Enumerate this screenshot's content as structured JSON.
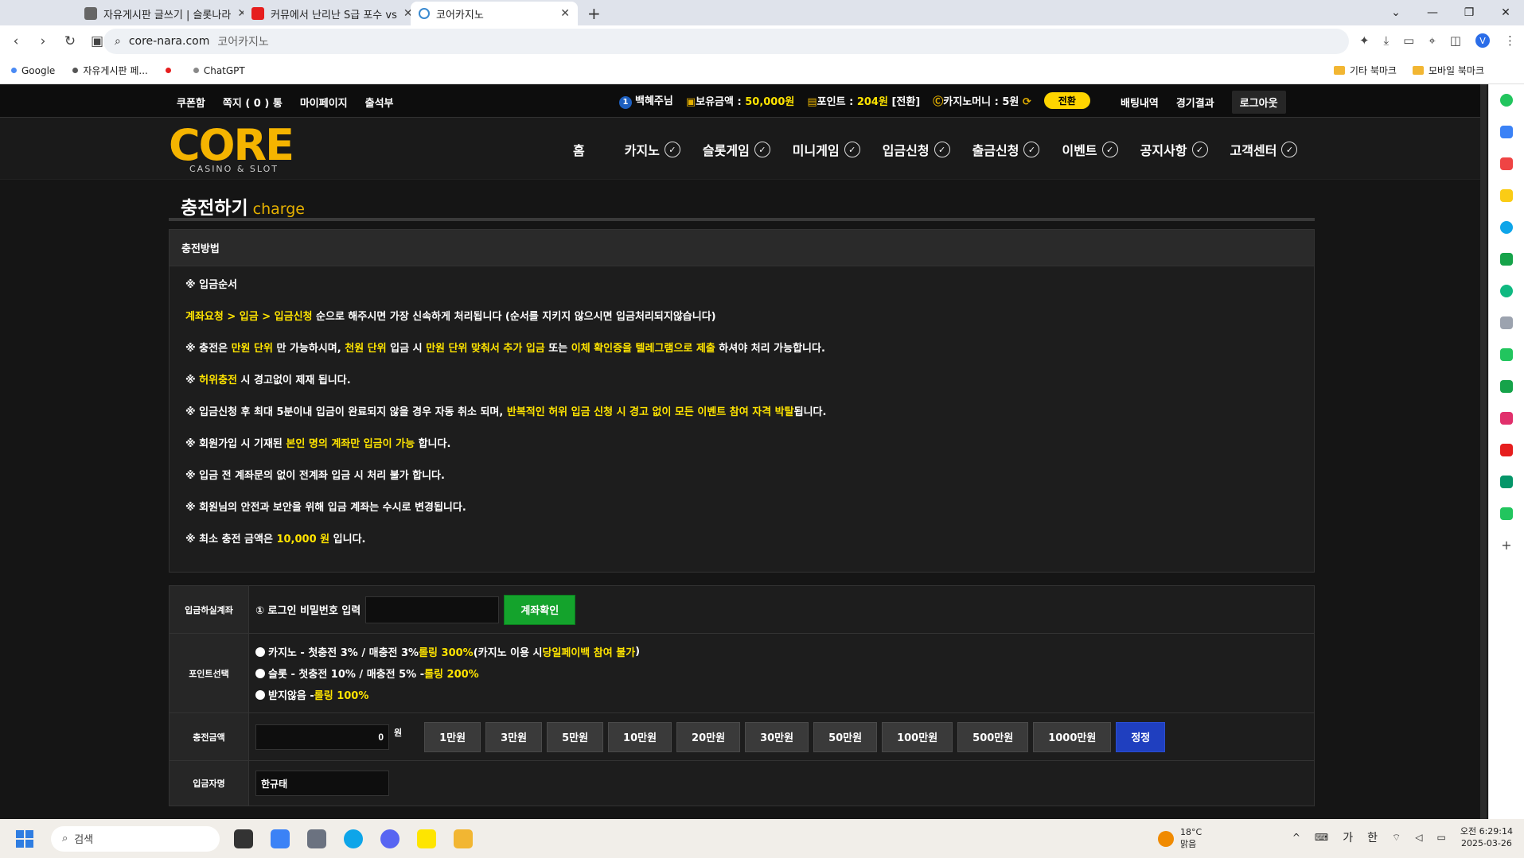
{
  "browser": {
    "tabs": [
      {
        "title": "자유게시판 글쓰기 | 슬롯나라",
        "color": "#666"
      },
      {
        "title": "커뮤에서 난리난 S급 포수 vs",
        "color": "#e61e1e"
      },
      {
        "title": "코어카지노",
        "color": "#3a8ad0"
      }
    ],
    "url": "core-nara.com",
    "url_title": "코어카지노",
    "profile_initial": "V",
    "bookmarks": [
      {
        "label": "Google"
      },
      {
        "label": "자유게시판 페..."
      },
      {
        "label": ""
      },
      {
        "label": "ChatGPT"
      }
    ],
    "bookmark_folders": [
      "기타 북마크",
      "모바일 북마크"
    ]
  },
  "site": {
    "top_left": [
      "쿠폰함",
      "쪽지 ( 0 ) 통",
      "마이페이지",
      "출석부"
    ],
    "user": {
      "level": "1",
      "name": "백혜주님"
    },
    "balance": {
      "label": "보유금액 : ",
      "value": "50,000원"
    },
    "points": {
      "label": "포인트 : ",
      "value": "204원",
      "suffix": " [전환]"
    },
    "casino_money": {
      "label": "카지노머니 : 5원"
    },
    "swap_label": "전환",
    "top_right": [
      "배팅내역",
      "경기결과"
    ],
    "logout": "로그아웃",
    "logo": {
      "text": "CORE",
      "sub": "CASINO & SLOT"
    },
    "menu": [
      "홈",
      "카지노",
      "슬롯게임",
      "미니게임",
      "입금신청",
      "출금신청",
      "이벤트",
      "공지사항",
      "고객센터"
    ],
    "page_title": {
      "ko": "충전하기",
      "en": "charge"
    },
    "method": {
      "header": "충전방법",
      "l1": "※ 입금순서",
      "l2": {
        "h": "계좌요청 > 입금 > 입금신청",
        "t": " 순으로 해주시면 가장 신속하게 처리됩니다 (순서를 지키지 않으시면 입금처리되지않습니다)"
      },
      "l3": {
        "a": "※ 충전은 ",
        "b": "만원 단위",
        "c": " 만 가능하시며, ",
        "d": "천원 단위",
        "e": " 입금 시 ",
        "f": "만원 단위 맞춰서 추가 입금",
        "g": " 또는 ",
        "h": "이체 확인증을 텔레그램으로 제출",
        "i": " 하셔야 처리 가능합니다."
      },
      "l4": {
        "a": "※ ",
        "b": "허위충전",
        "c": " 시 경고없이 제재 됩니다."
      },
      "l5": {
        "a": "※ 입금신청 후 최대 5분이내 입금이 완료되지 않을 경우 자동 취소 되며, ",
        "b": "반복적인 허위 입금 신청 시 경고 없이 모든 이벤트 참여 자격 박탈",
        "c": "됩니다."
      },
      "l6": {
        "a": "※ 회원가입 시 기재된 ",
        "b": "본인 명의 계좌만 입금이 가능",
        "c": " 합니다."
      },
      "l7": "※ 입금 전 계좌문의 없이 전계좌 입금 시 처리 불가 합니다.",
      "l8": "※ 회원님의 안전과 보안을 위해 입금 계좌는 수시로 변경됩니다.",
      "l9": {
        "a": "※ 최소 충전 금액은 ",
        "b": "10,000 원",
        "c": " 입니다."
      }
    },
    "form": {
      "account_label": "입금하실계좌",
      "pw_label": "① 로그인 비밀번호 입력",
      "confirm_btn": "계좌확인",
      "point_label": "포인트선택",
      "opt1": {
        "a": "카지노 - 첫충전 3% / 매충전 3% ",
        "b": "롤링 300%",
        "c": " (카지노 이용 시 ",
        "d": "당일페이백 참여 불가",
        "e": ")"
      },
      "opt2": {
        "a": "슬롯 - 첫충전 10% / 매충전 5% - ",
        "b": "롤링 200%"
      },
      "opt3": {
        "a": "받지않음 - ",
        "b": "롤링 100%"
      },
      "amount_label": "충전금액",
      "amount_value": "0",
      "won": "원",
      "amount_buttons": [
        "1만원",
        "3만원",
        "5만원",
        "10만원",
        "20만원",
        "30만원",
        "50만원",
        "100만원",
        "500만원",
        "1000만원"
      ],
      "reset_btn": "정정",
      "depositor_label": "입금자명",
      "depositor_value": "한규태"
    }
  },
  "taskbar": {
    "search": "검색",
    "weather_temp": "18°C",
    "weather_desc": "맑음",
    "ime1": "가",
    "ime2": "한",
    "time": "오전 6:29:14",
    "date": "2025-03-26"
  }
}
